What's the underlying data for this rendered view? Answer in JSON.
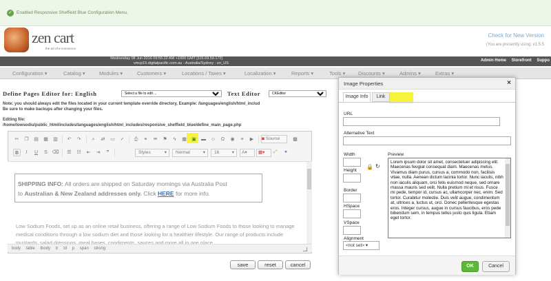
{
  "notice": {
    "message": "Enabled Responsive Sheffield Blue Configuration Menu."
  },
  "brand": {
    "name": "zen cart",
    "tagline": "the art of e-commerce"
  },
  "update": {
    "link": "Check for New Version",
    "version": "(You are presently using: v1.5.5"
  },
  "infobar": {
    "datetime": "Wednesday 08 Jun 2016 09:55:22 AM +1000 GMT [115.69.59.172]",
    "host": "vmcp15.digitalpacific.com.au - Australia/Sydney - en_US",
    "links": [
      "Admin Home",
      "Storefront",
      "Suppo"
    ]
  },
  "nav": [
    "Configuration ▾",
    "Catalog ▾",
    "Modules ▾",
    "Customers ▾",
    "Locations / Taxes ▾",
    "Localization ▾",
    "Reports ▾",
    "Tools ▾",
    "Discounts ▾",
    "Admins ▾",
    "Extras ▾"
  ],
  "page": {
    "title": "Define Pages Editor for:  English",
    "file_select": "Select a file to edit ...",
    "editor_label": "Text Editor",
    "editor_select": "CKEditor",
    "note_line1": "Note: you should always edit the files located in your current template override directory, Example: /languages/english/html_includ",
    "note_line2": "Be sure to make backups after changing your files.",
    "file_label": "Editing file:",
    "file_path": "/home/lowsodiu/public_html/includes/languages/english/html_includes/responsive_sheffield_blue/define_main_page.php"
  },
  "editor": {
    "source_label": "Source",
    "styles": "Styles",
    "format": "Normal",
    "size": "16",
    "shipping_heading": "SHIPPING INFO:",
    "shipping_text": " All orders are shipped on Saturday mornings via Australia Post",
    "shipping_to": "to ",
    "shipping_bold": "Australian & New Zealand addresses only.",
    "shipping_click": "  Click ",
    "shipping_link": "HERE",
    "shipping_more": " for more info.",
    "paragraph": "Low Sodium Foods, set up as an online retail business, offering a range of Low Sodium Foods to those looking to manage medical conditions through a low sodium diet and those looking for a healthier lifestyle. Our range of products include mustards, salad dressings, meal bases, condiments, sauces and more all in one place",
    "path": [
      "body",
      "table",
      "tbody",
      "tr",
      "td",
      "p",
      "span",
      "strong"
    ]
  },
  "form_buttons": {
    "save": "save",
    "reset": "reset",
    "cancel": "cancel"
  },
  "dialog": {
    "title": "Image Properties",
    "close": "×",
    "tabs": [
      "Image Info",
      "Link"
    ],
    "url_label": "URL",
    "alt_label": "Alternative Text",
    "width_label": "Width",
    "height_label": "Height",
    "border_label": "Border",
    "hspace_label": "HSpace",
    "vspace_label": "VSpace",
    "alignment_label": "Alignment",
    "alignment_value": "<not set>  ▾",
    "preview_label": "Preview",
    "preview_text": "Lorem ipsum dolor sit amet, consectetuer adipiscing elit. Maecenas feugiat consequat diam. Maecenas metus. Vivamus diam purus, cursus a, commodo non, facilisis vitae, nulla. Aenean dictum lacinia tortor. Nunc iaculis, nibh non iaculis aliquam, orci felis euismod neque, sed ornare massa mauris sed velit. Nulla pretium mi et risus. Fusce mi pede, tempor id, cursus ac, ullamcorper nec, enim. Sed tortor. Curabitur molestie. Duis velit augue, condimentum at, ultrices a, luctus ut, orci. Donec pellentesque egestas eros. Integer cursus, augue in cursus faucibus, eros pede bibendum sem, in tempus tellus justo quis ligula. Etiam eget tortor.",
    "ok": "OK",
    "cancel": "Cancel"
  },
  "colors": {
    "highlight": "#f7f33a",
    "ok_green": "#5db73a",
    "link_blue": "#3a6fb5"
  }
}
